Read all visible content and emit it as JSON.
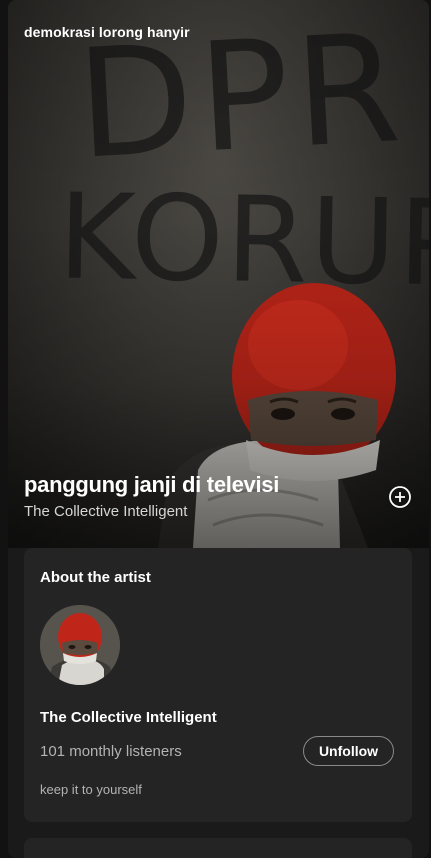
{
  "now_playing_view": {
    "context_title": "demokrasi lorong hanyir",
    "track": {
      "title": "panggung janji di televisi",
      "artist": "The Collective Intelligent"
    },
    "cover_art": {
      "wall_text": "DPR KORUP"
    },
    "add_icon": "plus-circle-icon",
    "about_artist": {
      "heading": "About the artist",
      "artist_name": "The Collective Intelligent",
      "monthly_listeners": "101 monthly listeners",
      "follow_label": "Unfollow",
      "bio": "keep it to yourself"
    }
  },
  "colors": {
    "background": "#121212",
    "card": "#242424",
    "text_primary": "#ffffff",
    "text_secondary": "#b3b3b3",
    "mask_red": "#c8281d"
  }
}
